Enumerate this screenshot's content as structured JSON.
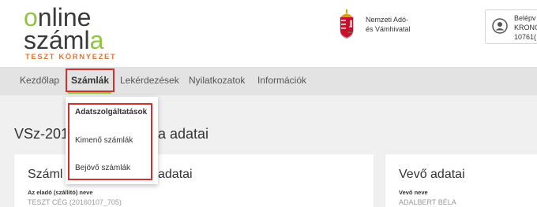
{
  "logo": {
    "line1_a": "o",
    "line1_b": "nline",
    "line2_a": "száml",
    "line2_b": "a",
    "subtitle": "TESZT KÖRNYEZET"
  },
  "agency": {
    "line1": "Nemzeti Adó-",
    "line2": "és Vámhivatal"
  },
  "user": {
    "line1": "Belépv",
    "line2": "KRONC",
    "line3": "10761("
  },
  "nav": {
    "items": [
      "Kezdőlap",
      "Számlák",
      "Lekérdezések",
      "Nyilatkozatok",
      "Információk"
    ],
    "active": "Számlák"
  },
  "dropdown": {
    "items": [
      "Adatszolgáltatások",
      "Kimenő számlák",
      "Bejövő számlák"
    ]
  },
  "main": {
    "title_start": "VSz-201",
    "title_end": "a adatai",
    "seller_card": {
      "title_start": "Száml",
      "title_end": "adatai",
      "field_label": "Az eladó (szállító) neve",
      "field_value": "TESZT CÉG (20160107_705)"
    },
    "buyer_card": {
      "title": "Vevő adatai",
      "field_label": "Vevő neve",
      "field_value": "ADALBERT BÉLA"
    }
  },
  "colors": {
    "brand_green": "#8cc63f",
    "test_orange": "#e8732e",
    "highlight_red": "#d32f2f"
  }
}
